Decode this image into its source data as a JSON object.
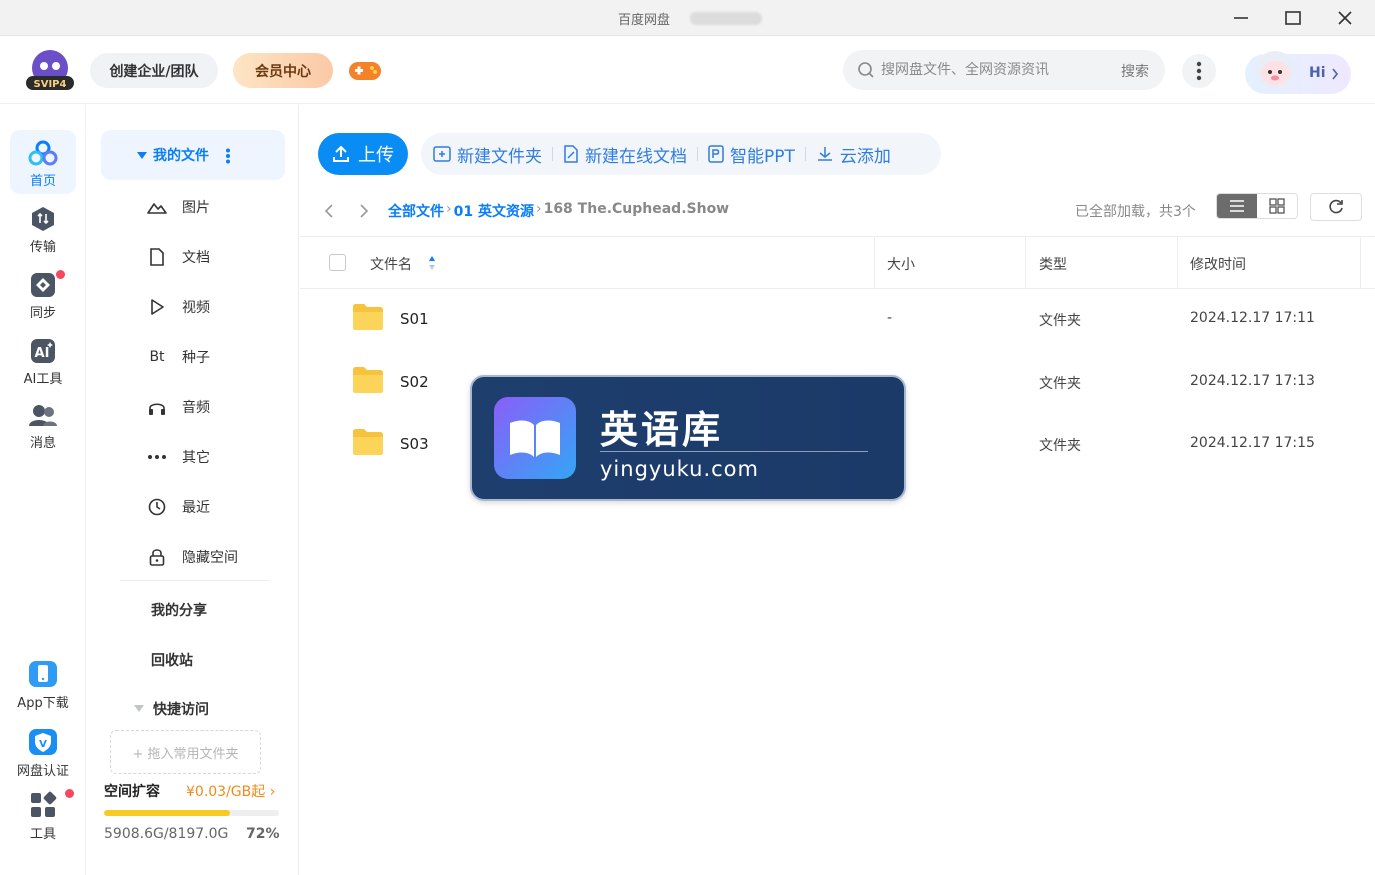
{
  "window": {
    "title": "百度网盘"
  },
  "header": {
    "logo_text": "SVIP4",
    "team_button": "创建企业/团队",
    "vip_button": "会员中心",
    "search": {
      "placeholder": "搜网盘文件、全网资源资讯",
      "button": "搜索"
    },
    "hi_label": "Hi"
  },
  "rail": {
    "items": [
      {
        "label": "首页",
        "icon": "home-icon",
        "active": true
      },
      {
        "label": "传输",
        "icon": "transfer-icon"
      },
      {
        "label": "同步",
        "icon": "sync-icon",
        "badge": true
      },
      {
        "label": "AI工具",
        "icon": "ai-tools-icon"
      },
      {
        "label": "消息",
        "icon": "message-icon"
      }
    ],
    "bottom_items": [
      {
        "label": "App下载",
        "icon": "app-download-icon"
      },
      {
        "label": "网盘认证",
        "icon": "verify-icon"
      },
      {
        "label": "工具",
        "icon": "tools-icon",
        "badge": true
      }
    ]
  },
  "sidenav": {
    "my_files": "我的文件",
    "items": [
      {
        "label": "图片",
        "icon": "image-icon"
      },
      {
        "label": "文档",
        "icon": "document-icon"
      },
      {
        "label": "视频",
        "icon": "video-icon"
      },
      {
        "label": "种子",
        "icon": "torrent-icon",
        "glyph": "Bt"
      },
      {
        "label": "音频",
        "icon": "audio-icon"
      },
      {
        "label": "其它",
        "icon": "other-icon"
      },
      {
        "label": "最近",
        "icon": "recent-icon"
      },
      {
        "label": "隐藏空间",
        "icon": "lock-icon"
      }
    ],
    "my_share": "我的分享",
    "recycle_bin": "回收站",
    "quick_access": "快捷访问",
    "drop_hint": "+ 拖入常用文件夹",
    "storage": {
      "title": "空间扩容",
      "price": "¥0.03/GB起",
      "used": "5908.6G/8197.0G",
      "percent_label": "72%",
      "fraction": 0.72
    }
  },
  "toolbar": {
    "upload": "上传",
    "actions": [
      {
        "label": "新建文件夹",
        "icon": "new-folder-icon"
      },
      {
        "label": "新建在线文档",
        "icon": "new-doc-icon"
      },
      {
        "label": "智能PPT",
        "icon": "ppt-icon"
      },
      {
        "label": "云添加",
        "icon": "cloud-add-icon"
      }
    ]
  },
  "breadcrumb": {
    "links": [
      "全部文件",
      "01 英文资源"
    ],
    "current": "168 The.Cuphead.Show",
    "status": "已全部加载，共3个"
  },
  "table": {
    "columns": {
      "name": "文件名",
      "size": "大小",
      "type": "类型",
      "modified": "修改时间"
    },
    "rows": [
      {
        "name": "S01",
        "size": "-",
        "type": "文件夹",
        "modified": "2024.12.17 17:11"
      },
      {
        "name": "S02",
        "size": "",
        "type": "文件夹",
        "modified": "2024.12.17 17:13"
      },
      {
        "name": "S03",
        "size": "",
        "type": "文件夹",
        "modified": "2024.12.17 17:15"
      }
    ]
  },
  "watermark": {
    "title": "英语库",
    "url": "yingyuku.com"
  },
  "colors": {
    "accent": "#0a7df8",
    "upload": "#0a8cf5",
    "storage_fill": "#f7cb23",
    "badge": "#f5495c"
  }
}
